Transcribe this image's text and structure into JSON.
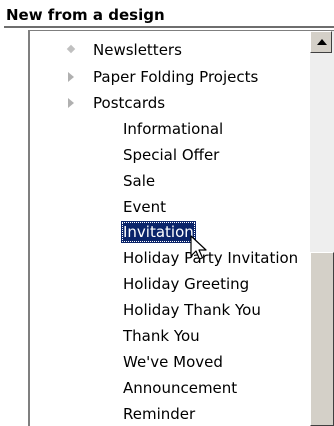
{
  "header": {
    "title": "New from a design"
  },
  "tree": {
    "categories": [
      {
        "label": "Newsletters",
        "marker": "diamond-bullet-icon"
      },
      {
        "label": "Paper Folding Projects",
        "marker": "collapsed-arrow-icon"
      },
      {
        "label": "Postcards",
        "marker": "expanded-arrow-icon"
      }
    ],
    "postcard_items": [
      "Informational",
      "Special Offer",
      "Sale",
      "Event",
      "Invitation",
      "Holiday Party Invitation",
      "Holiday Greeting",
      "Holiday Thank You",
      "Thank You",
      "We've Moved",
      "Announcement",
      "Reminder"
    ],
    "selected_item": "Invitation"
  },
  "scrollbar": {
    "up_icon": "scroll-up-arrow-icon"
  },
  "colors": {
    "selection_bg": "#0a246a",
    "selection_text": "#ffffff",
    "marker_gray": "#b0b0b0"
  }
}
